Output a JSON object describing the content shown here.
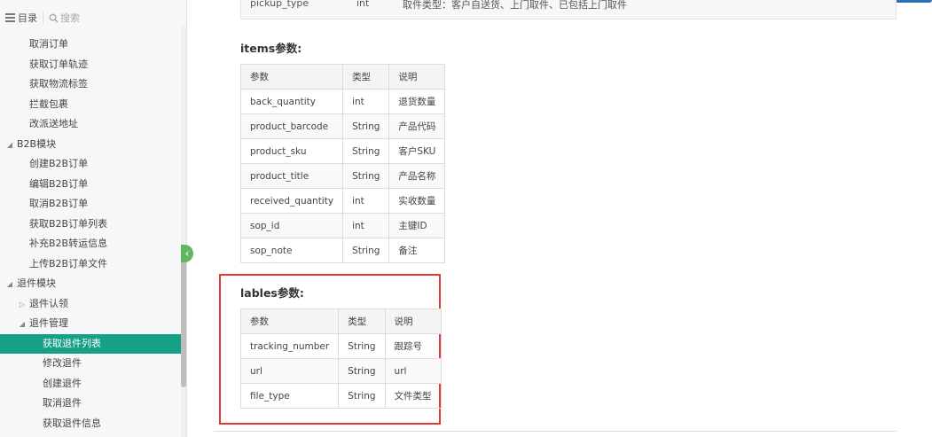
{
  "sidebar": {
    "toc_label": "目录",
    "search_placeholder": "搜索",
    "items": [
      {
        "label": "取消订单",
        "level": 2
      },
      {
        "label": "获取订单轨迹",
        "level": 2
      },
      {
        "label": "获取物流标签",
        "level": 2
      },
      {
        "label": "拦截包裹",
        "level": 2
      },
      {
        "label": "改派送地址",
        "level": 2
      },
      {
        "label": "B2B模块",
        "level": 1,
        "caret": "open"
      },
      {
        "label": "创建B2B订单",
        "level": 2
      },
      {
        "label": "编辑B2B订单",
        "level": 2
      },
      {
        "label": "取消B2B订单",
        "level": 2
      },
      {
        "label": "获取B2B订单列表",
        "level": 2
      },
      {
        "label": "补充B2B转运信息",
        "level": 2
      },
      {
        "label": "上传B2B订单文件",
        "level": 2
      },
      {
        "label": "退件模块",
        "level": 1,
        "caret": "open"
      },
      {
        "label": "退件认领",
        "level": 2,
        "caret": "closed"
      },
      {
        "label": "退件管理",
        "level": 2,
        "caret": "open"
      },
      {
        "label": "获取退件列表",
        "level": 3,
        "active": true
      },
      {
        "label": "修改退件",
        "level": 3
      },
      {
        "label": "创建退件",
        "level": 3
      },
      {
        "label": "取消退件",
        "level": 3
      },
      {
        "label": "获取退件信息",
        "level": 3
      }
    ]
  },
  "top_row": {
    "name": "pickup_type",
    "type": "int",
    "desc": "取件类型：客户自送货、上门取件、已包括上门取件"
  },
  "items_section": {
    "title": "items参数:",
    "headers": [
      "参数",
      "类型",
      "说明"
    ],
    "rows": [
      [
        "back_quantity",
        "int",
        "退货数量"
      ],
      [
        "product_barcode",
        "String",
        "产品代码"
      ],
      [
        "product_sku",
        "String",
        "客户SKU"
      ],
      [
        "product_title",
        "String",
        "产品名称"
      ],
      [
        "received_quantity",
        "int",
        "实收数量"
      ],
      [
        "sop_id",
        "int",
        "主键ID"
      ],
      [
        "sop_note",
        "String",
        "备注"
      ]
    ]
  },
  "lables_section": {
    "title": "lables参数:",
    "headers": [
      "参数",
      "类型",
      "说明"
    ],
    "rows": [
      [
        "tracking_number",
        "String",
        "跟踪号"
      ],
      [
        "url",
        "String",
        "url"
      ],
      [
        "file_type",
        "String",
        "文件类型"
      ]
    ]
  },
  "colors": {
    "active": "#16a085",
    "highlight_border": "#e03b3b",
    "collapse_button": "#5fb85f"
  }
}
